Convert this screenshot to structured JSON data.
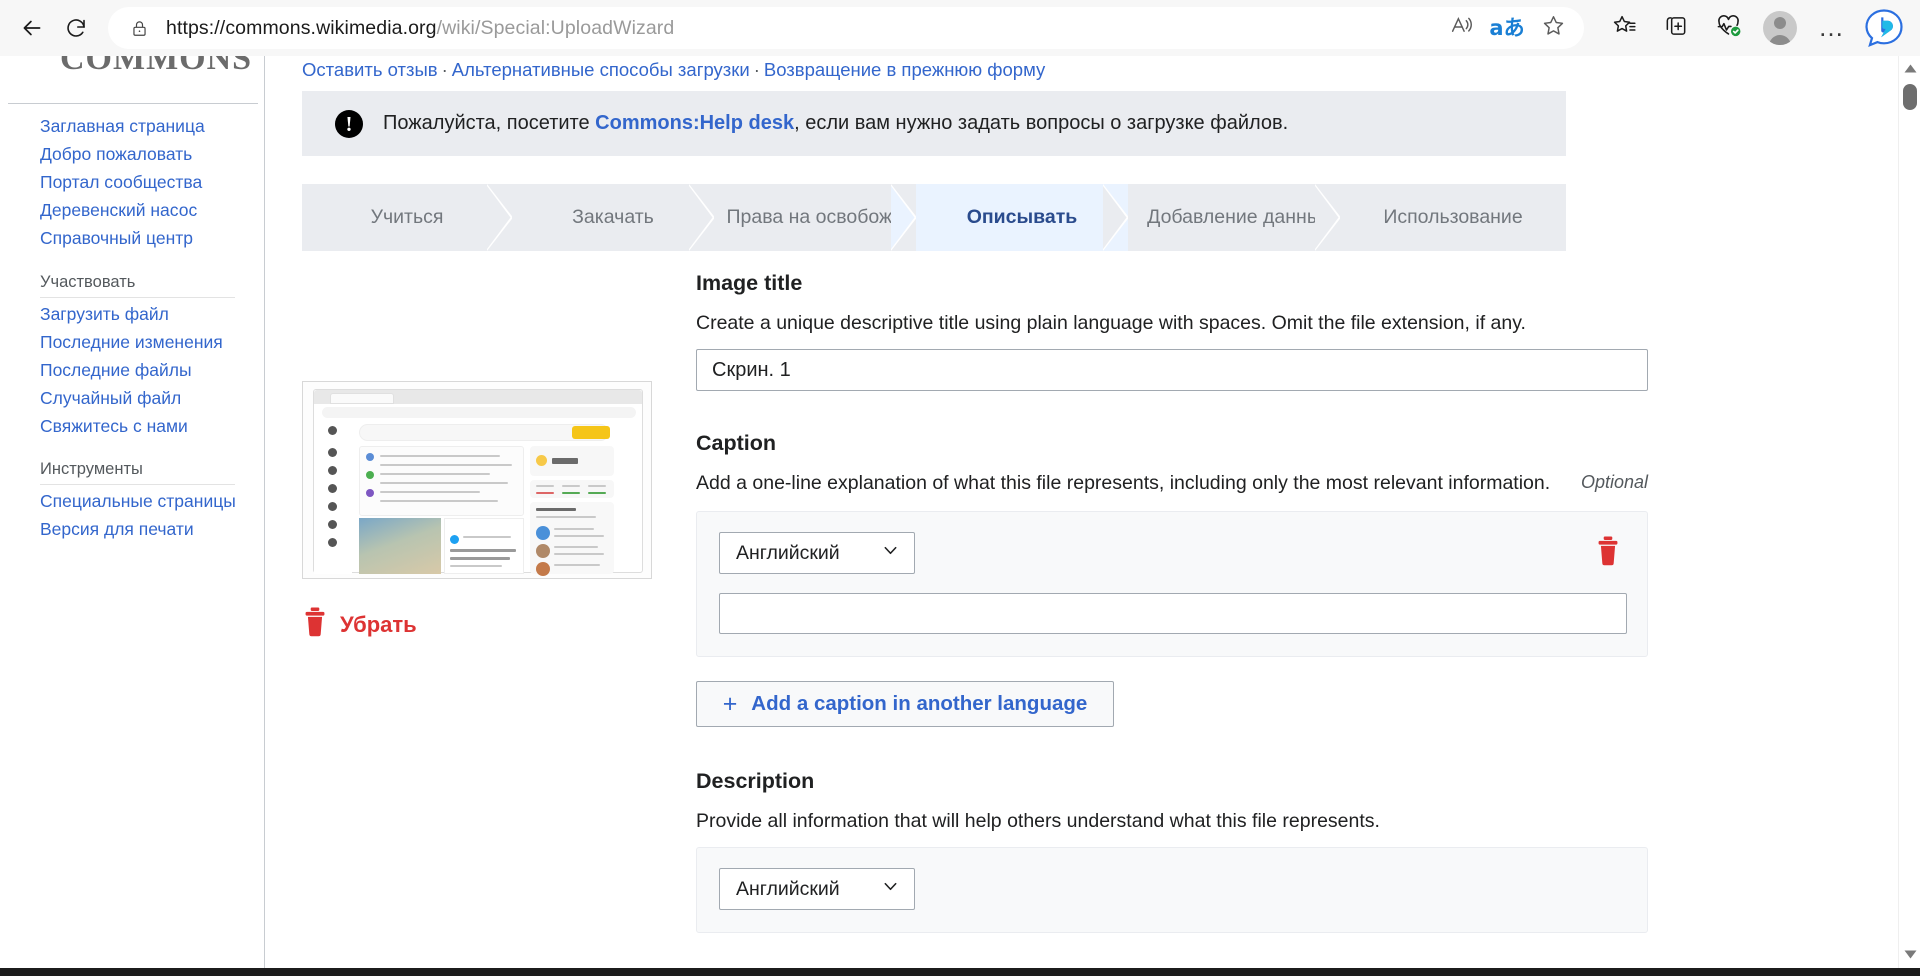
{
  "browser": {
    "back_icon": "back-arrow-icon",
    "reload_icon": "reload-icon",
    "lock_icon": "lock-icon",
    "url_host": "https://commons.wikimedia.org",
    "url_path": "/wiki/Special:UploadWizard",
    "read_aloud_icon": "read-aloud-icon",
    "translate_icon": "aあ",
    "favorite_icon": "star-icon",
    "favorites_list_icon": "favorites-list-icon",
    "collections_icon": "collections-add-icon",
    "browser_essentials_icon": "browser-essentials-heart-icon",
    "profile_icon": "profile-avatar-icon",
    "settings_icon": "…",
    "copilot_icon": "bing-copilot-icon"
  },
  "sidebar": {
    "wordmark": "COMMONS",
    "primary_links": [
      "Заглавная страница",
      "Добро пожаловать",
      "Портал сообщества",
      "Деревенский насос",
      "Справочный центр"
    ],
    "groups": [
      {
        "heading": "Участвовать",
        "links": [
          "Загрузить файл",
          "Последние изменения",
          "Последние файлы",
          "Случайный файл",
          "Свяжитесь с нами"
        ]
      },
      {
        "heading": "Инструменты",
        "links": [
          "Специальные страницы",
          "Версия для печати"
        ]
      }
    ]
  },
  "top_links": {
    "feedback": "Оставить отзыв",
    "alternative": "Альтернативные способы загрузки",
    "legacy": "Возвращение в прежнюю форму",
    "separator": "·"
  },
  "notice": {
    "icon": "exclamation-icon",
    "text_before": "Пожалуйста, посетите ",
    "link": "Commons:Help desk",
    "text_after": ", если вам нужно задать вопросы о загрузке файлов."
  },
  "steps": [
    {
      "label": "Учиться",
      "active": false
    },
    {
      "label": "Закачать",
      "active": false
    },
    {
      "label": "Права на освобожд",
      "active": false
    },
    {
      "label": "Описывать",
      "active": true
    },
    {
      "label": "Добавление данны",
      "active": false
    },
    {
      "label": "Использование",
      "active": false
    }
  ],
  "thumbnail": {
    "remove_label": "Убрать",
    "remove_icon": "trash-icon"
  },
  "form": {
    "image_title": {
      "heading": "Image title",
      "description": "Create a unique descriptive title using plain language with spaces. Omit the file extension, if any.",
      "value": "Скрин. 1",
      "placeholder": ""
    },
    "caption": {
      "heading": "Caption",
      "description": "Add a one-line explanation of what this file represents, including only the most relevant information.",
      "optional_tag": "Optional",
      "language": "Английский",
      "chevron_icon": "chevron-down-icon",
      "delete_icon": "trash-icon",
      "value": "",
      "add_button_label": "Add a caption in another language",
      "add_button_icon": "plus-icon"
    },
    "description": {
      "heading": "Description",
      "description": "Provide all information that will help others understand what this file represents.",
      "language": "Английский",
      "chevron_icon": "chevron-down-icon"
    }
  },
  "scrollbar": {
    "up_icon": "scroll-up-arrow-icon",
    "down_icon": "scroll-down-arrow-icon"
  },
  "colors": {
    "link": "#3366cc",
    "active_step_text": "#2a4b8d",
    "active_step_bg": "#eaf3ff",
    "step_bg": "#eaecf0",
    "danger": "#d33",
    "notice_bg": "#eaecf0"
  }
}
